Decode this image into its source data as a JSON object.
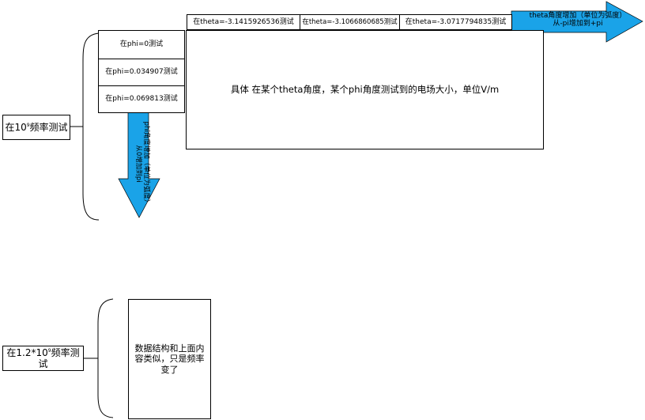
{
  "freq1": {
    "prefix": "在10",
    "sup": "9",
    "suffix": "频率测试"
  },
  "freq2": {
    "prefix": "在1.2*10",
    "sup": "9",
    "suffix": "频率测试"
  },
  "phi_rows": [
    "在phi=0测试",
    "在phi=0.034907测试",
    "在phi=0.069813测试"
  ],
  "theta_cols": [
    "在theta=-3.1415926536测试",
    "在theta=-3.1066860685测试",
    "在theta=-3.0717794835测试"
  ],
  "main_box": "具体 在某个theta角度，某个phi角度测试到的电场大小，单位V/m",
  "theta_arrow": {
    "line1": "theta角度增加（单位为弧度）",
    "line2": "从-pi增加到+pi"
  },
  "phi_arrow": {
    "line1": "phi角度增加（单位为弧度）",
    "line2": "从0增加到pi"
  },
  "note_box": "数据结构和上面内容类似，只是频率变了",
  "colors": {
    "arrow_fill": "#1aa3e8",
    "border": "#000000"
  }
}
